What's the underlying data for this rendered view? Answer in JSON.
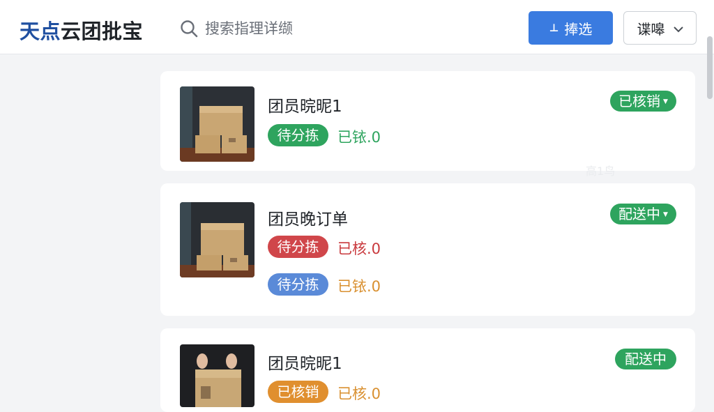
{
  "header": {
    "logo_part1": "天点",
    "logo_part2": "云团批宝",
    "search_placeholder": "搜索指理详缬",
    "filter_label": "捧选",
    "filter_icon": "download-icon",
    "sort_label": "谍嗥"
  },
  "orders": [
    {
      "title": "团员晥昵1",
      "status": "已核销",
      "status_color": "#2ea45e",
      "faint_text": "高1鸟",
      "rows": [
        {
          "pill": "待分拣",
          "pill_color": "#2ea45e",
          "note": "已铱.0",
          "note_color": "#2ea45e"
        }
      ]
    },
    {
      "title": "团员晚订单",
      "status": "配送中",
      "status_color": "#2ea45e",
      "rows": [
        {
          "pill": "待分拣",
          "pill_color": "#d0464a",
          "note": "已核.0",
          "note_color": "#c9393d"
        },
        {
          "pill": "待分拣",
          "pill_color": "#5a8ad8",
          "note": "已铱.0",
          "note_color": "#d99030"
        }
      ]
    },
    {
      "title": "团员晥昵1",
      "status": "配送中",
      "status_color": "#2ea45e",
      "rows": [
        {
          "pill": "已核销",
          "pill_color": "#e08f2f",
          "note": "已核.0",
          "note_color": "#d99030"
        }
      ]
    }
  ]
}
